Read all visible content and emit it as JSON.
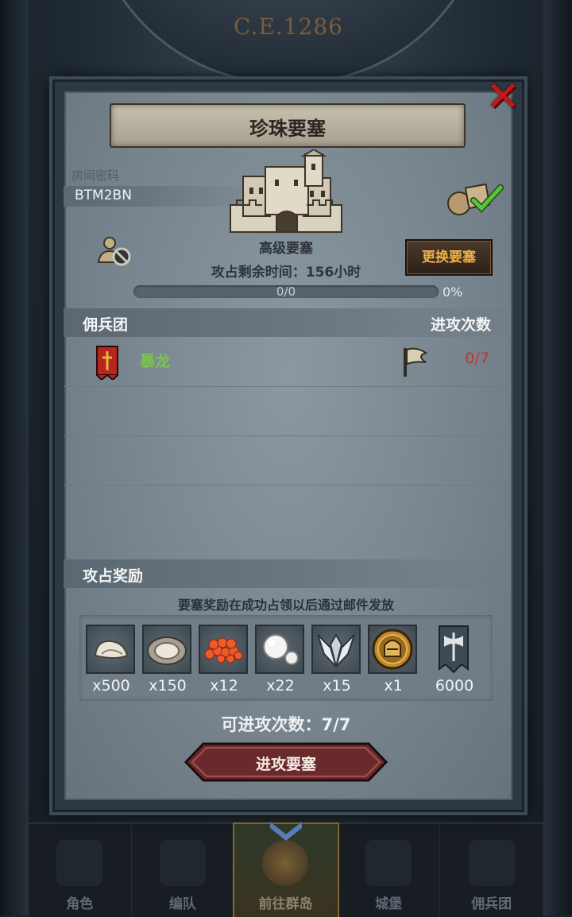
{
  "header": {
    "era": "C.E.1286"
  },
  "dialog": {
    "title": "珍珠要塞",
    "room_password_label": "房间密码",
    "room_password_value": "BTM2BN",
    "fort_level": "高级要塞",
    "change_fort_label": "更换要塞",
    "remaining_time_label": "攻占剩余时间：156小时",
    "progress_text": "0/0",
    "progress_percent": "0%",
    "progress_fraction": 0,
    "mercenary_section": {
      "left_label": "佣兵团",
      "right_label": "进攻次数"
    },
    "mercenaries": [
      {
        "name": "暴龙",
        "attacks": "0/7"
      }
    ],
    "reward_section": {
      "label": "攻占奖励",
      "note": "要塞奖励在成功占领以后通过邮件发放"
    },
    "rewards": [
      {
        "icon": "conch-shell-icon",
        "qty": "x500"
      },
      {
        "icon": "oyster-icon",
        "qty": "x150"
      },
      {
        "icon": "fish-roe-icon",
        "qty": "x12"
      },
      {
        "icon": "pearl-icon",
        "qty": "x22"
      },
      {
        "icon": "winged-emblem-icon",
        "qty": "x15"
      },
      {
        "icon": "knight-helmet-coin-icon",
        "qty": "x1"
      },
      {
        "icon": "axe-banner-icon",
        "qty": "6000"
      }
    ],
    "attempts_label": "可进攻次数：7/7",
    "attack_button_label": "进攻要塞"
  },
  "bottom_nav": [
    {
      "label": "角色",
      "active": false
    },
    {
      "label": "编队",
      "active": false
    },
    {
      "label": "前往群岛",
      "active": true
    },
    {
      "label": "城堡",
      "active": false
    },
    {
      "label": "佣兵团",
      "active": false
    }
  ],
  "colors": {
    "close": "#c0191a",
    "mercenary_name": "#79c64c",
    "attack_count": "#c0352e",
    "change_button_text": "#f0b046"
  }
}
